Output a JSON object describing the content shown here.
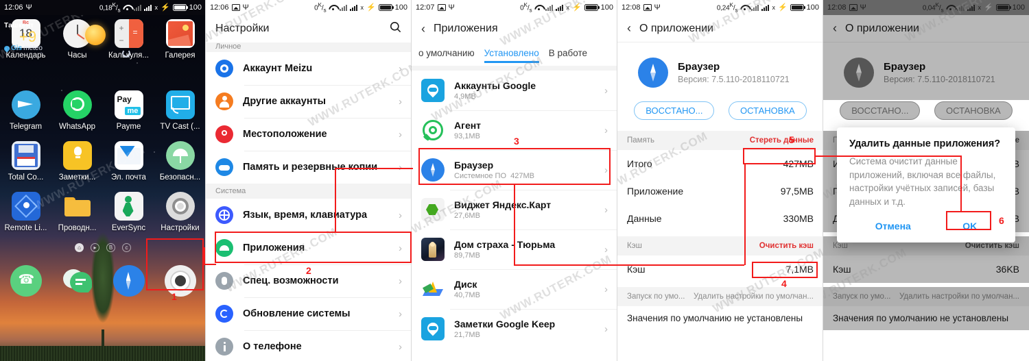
{
  "panels": [
    {
      "id": "home-screen",
      "status": {
        "time": "12:06",
        "rate": "0,18",
        "battery": "100"
      },
      "widget": {
        "city": "Ташкент",
        "temp": "+9",
        "source_prefix": "Gis",
        "source_suffix": "meteo"
      },
      "apps_row1": [
        {
          "label": "Календарь",
          "icon": "calendar-icon",
          "day": "18",
          "weekday": "Вс"
        },
        {
          "label": "Часы",
          "icon": "clock-icon"
        },
        {
          "label": "Калькуля...",
          "icon": "calculator-icon"
        },
        {
          "label": "Галерея",
          "icon": "gallery-icon"
        }
      ],
      "apps_row2": [
        {
          "label": "Telegram",
          "icon": "telegram-icon"
        },
        {
          "label": "WhatsApp",
          "icon": "whatsapp-icon"
        },
        {
          "label": "Payme",
          "icon": "payme-icon",
          "text_top": "Pay",
          "text_bottom": "me"
        },
        {
          "label": "TV Cast (...",
          "icon": "tv-cast-icon"
        }
      ],
      "apps_row3": [
        {
          "label": "Total Co...",
          "icon": "total-commander-icon"
        },
        {
          "label": "Заметки...",
          "icon": "notes-icon"
        },
        {
          "label": "Эл. почта",
          "icon": "email-icon"
        },
        {
          "label": "Безопасн...",
          "icon": "security-icon"
        }
      ],
      "apps_row4": [
        {
          "label": "Remote Li...",
          "icon": "remote-link-icon"
        },
        {
          "label": "Проводн...",
          "icon": "file-manager-icon"
        },
        {
          "label": "EverSync",
          "icon": "eversync-icon"
        },
        {
          "label": "Настройки",
          "icon": "settings-gear-icon"
        }
      ],
      "dock": [
        {
          "label": "Телефон",
          "icon": "phone-icon"
        },
        {
          "label": "Сообщения",
          "icon": "messages-icon"
        },
        {
          "label": "Браузер",
          "icon": "browser-compass-icon"
        },
        {
          "label": "Камера",
          "icon": "camera-icon"
        }
      ]
    },
    {
      "id": "settings-screen",
      "status": {
        "time": "12:06",
        "rate": "0",
        "battery": "100"
      },
      "title": "Настройки",
      "section_personal": "Личное",
      "section_system": "Система",
      "rows_personal": [
        {
          "label": "Аккаунт Meizu",
          "icon": "meizu-account-icon",
          "color": "#1a73e8"
        },
        {
          "label": "Другие аккаунты",
          "icon": "other-accounts-icon",
          "color": "#f57c20"
        },
        {
          "label": "Местоположение",
          "icon": "location-pin-icon",
          "color": "#ea2a33"
        },
        {
          "label": "Память и резервные копии",
          "icon": "backup-cloud-icon",
          "color": "#1e88e5"
        }
      ],
      "rows_system": [
        {
          "label": "Язык, время, клавиатура",
          "icon": "language-globe-icon",
          "color": "#3d5afe"
        },
        {
          "label": "Приложения",
          "icon": "apps-android-icon",
          "color": "#1bbf72"
        },
        {
          "label": "Спец. возможности",
          "icon": "accessibility-hand-icon",
          "color": "#9aa4ad"
        },
        {
          "label": "Обновление системы",
          "icon": "system-update-icon",
          "color": "#2962ff"
        },
        {
          "label": "О телефоне",
          "icon": "about-phone-info-icon",
          "color": "#9aa4ad"
        }
      ]
    },
    {
      "id": "apps-list-screen",
      "status": {
        "time": "12:07",
        "rate": "0",
        "battery": "100"
      },
      "title": "Приложения",
      "tabs": [
        {
          "label": "о умолчанию",
          "active": false
        },
        {
          "label": "Установлено",
          "active": true
        },
        {
          "label": "В работе",
          "active": false
        }
      ],
      "apps": [
        {
          "name": "Аккаунты Google",
          "size": "4,9MB",
          "icon": "google-accounts-icon"
        },
        {
          "name": "Агент",
          "size": "93,1MB",
          "icon": "agent-icon"
        },
        {
          "name": "Браузер",
          "size": "427MB",
          "tag": "Системное ПО",
          "icon": "browser-compass-icon"
        },
        {
          "name": "Виджет Яндекс.Карт",
          "size": "27,6MB",
          "icon": "yandex-maps-widget-icon"
        },
        {
          "name": "Дом страха - Тюрьма",
          "size": "89,7MB",
          "icon": "horror-house-game-icon"
        },
        {
          "name": "Диск",
          "size": "40,7MB",
          "icon": "google-drive-icon"
        },
        {
          "name": "Заметки Google Keep",
          "size": "21,7MB",
          "icon": "google-keep-icon"
        }
      ]
    },
    {
      "id": "app-info-screen",
      "status": {
        "time": "12:08",
        "rate": "0,24",
        "battery": "100"
      },
      "title": "О приложении",
      "app_name": "Браузер",
      "version": "Версия: 7.5.110-2018110721",
      "buttons": {
        "restore": "ВОССТАНО...",
        "stop": "ОСТАНОВКА"
      },
      "memory_header": "Память",
      "erase_data_action": "Стереть данные",
      "memory_rows": [
        {
          "label": "Итого",
          "value": "427MB"
        },
        {
          "label": "Приложение",
          "value": "97,5MB"
        },
        {
          "label": "Данные",
          "value": "330MB"
        }
      ],
      "cache_header": "Кэш",
      "clear_cache_action": "Очистить кэш",
      "cache_row": {
        "label": "Кэш",
        "value": "7,1MB"
      },
      "defaults_header_left": "Запуск по умо...",
      "defaults_header_right": "Удалить настройки по умолчан...",
      "defaults_note": "Значения по умолчанию не установлены"
    },
    {
      "id": "app-info-dialog-screen",
      "status": {
        "time": "12:08",
        "rate": "0,04",
        "battery": "100"
      },
      "title": "О приложении",
      "app_name": "Браузер",
      "version": "Версия: 7.5.110-2018110721",
      "buttons": {
        "restore": "ВОССТАНО...",
        "stop": "ОСТАНОВКА"
      },
      "dialog": {
        "title": "Удалить данные приложения?",
        "body": "Система очистит данные приложений, включая все файлы, настройки учётных записей, базы данных и т.д.",
        "cancel": "Отмена",
        "ok": "OK"
      },
      "memory_header": "Память",
      "erase_data_action": "Стереть данные",
      "memory_rows": [
        {
          "label": "Итого",
          "value": "427MB"
        },
        {
          "label": "Приложение",
          "value": "97,5MB"
        },
        {
          "label": "Данные",
          "value": "330MB"
        }
      ],
      "cache_header": "Кэш",
      "clear_cache_action": "Очистить кэш",
      "cache_row": {
        "label": "Кэш",
        "value": "36KB"
      },
      "defaults_header_left": "Запуск по умо...",
      "defaults_header_right": "Удалить настройки по умолчан...",
      "defaults_note": "Значения по умолчанию не установлены"
    }
  ],
  "annotations": {
    "step1": "1",
    "step2": "2",
    "step3": "3",
    "step4": "4",
    "step5": "5",
    "step6": "6",
    "color": "#f21b1b"
  },
  "watermark": "WWW.RUTERK.COM"
}
